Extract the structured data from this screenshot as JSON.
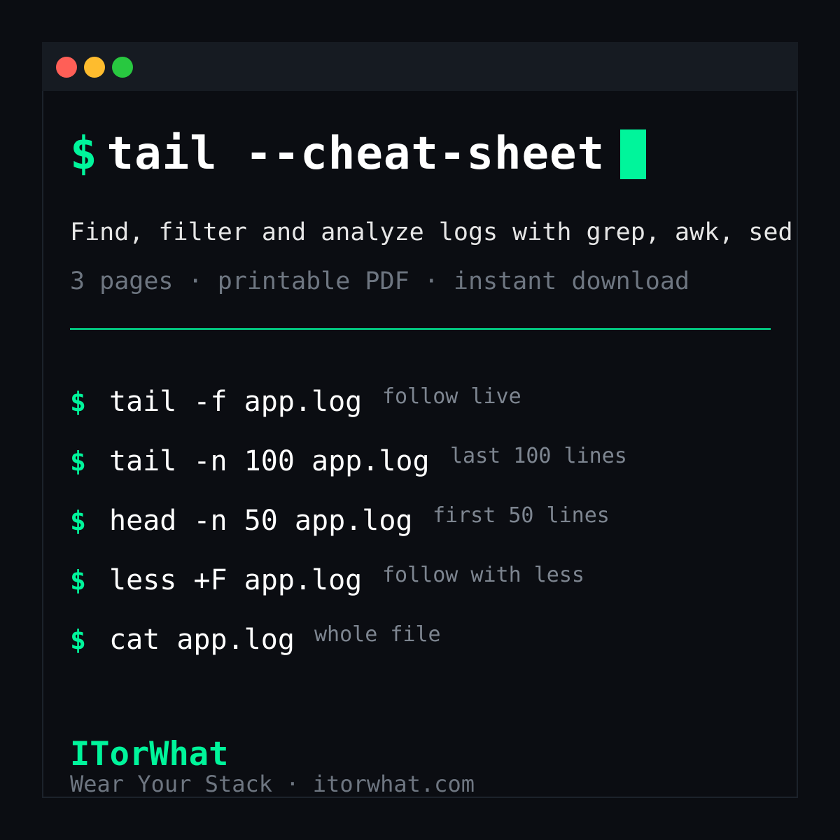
{
  "window": {
    "controls": [
      "close",
      "minimize",
      "maximize"
    ]
  },
  "heading": {
    "prompt": "$",
    "command": "tail --cheat-sheet"
  },
  "description": "Find, filter and analyze logs with grep, awk, sed",
  "meta": "3 pages · printable PDF · instant download",
  "commands": [
    {
      "prompt": "$",
      "cmd": "tail -f app.log",
      "note": "follow live"
    },
    {
      "prompt": "$",
      "cmd": "tail -n 100 app.log",
      "note": "last 100 lines"
    },
    {
      "prompt": "$",
      "cmd": "head -n 50 app.log",
      "note": "first 50 lines"
    },
    {
      "prompt": "$",
      "cmd": "less +F app.log",
      "note": "follow with less"
    },
    {
      "prompt": "$",
      "cmd": "cat app.log",
      "note": "whole file"
    }
  ],
  "brand": {
    "name": "ITorWhat",
    "tagline": "Wear Your Stack · itorwhat.com"
  },
  "colors": {
    "accent": "#00f59b",
    "background": "#0b0d12",
    "titlebar": "#161b22",
    "close": "#ff5f57",
    "minimize": "#febc2e",
    "maximize": "#28c840"
  }
}
